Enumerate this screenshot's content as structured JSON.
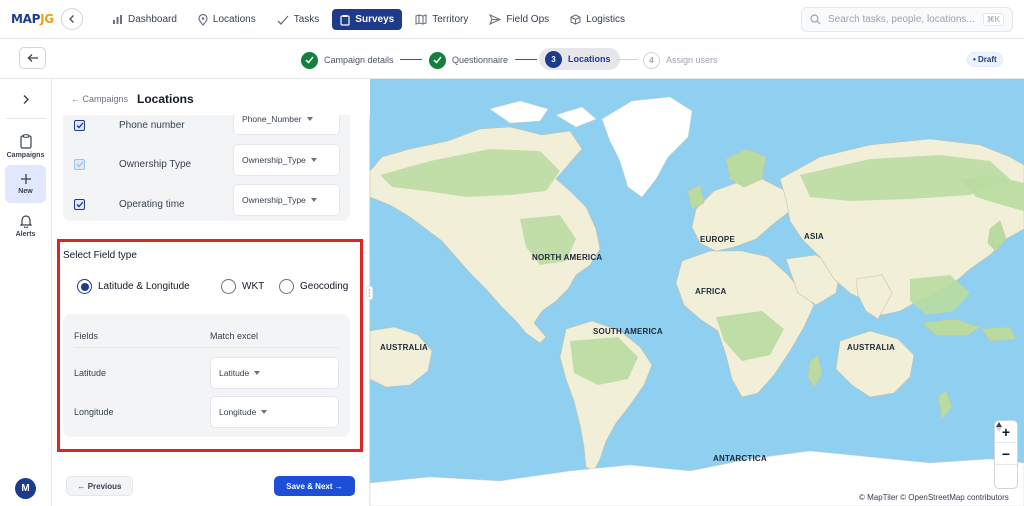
{
  "app": {
    "logo_main": "MAP",
    "logo_accent": "JG"
  },
  "nav": {
    "items": [
      {
        "label": "Dashboard",
        "icon": "bar-chart-icon"
      },
      {
        "label": "Locations",
        "icon": "pin-icon"
      },
      {
        "label": "Tasks",
        "icon": "check-icon"
      },
      {
        "label": "Surveys",
        "icon": "clipboard-icon",
        "active": true
      },
      {
        "label": "Territory",
        "icon": "map-icon"
      },
      {
        "label": "Field Ops",
        "icon": "send-icon"
      },
      {
        "label": "Logistics",
        "icon": "box-icon"
      }
    ]
  },
  "search": {
    "placeholder": "Search tasks, people, locations...",
    "shortcut": "⌘K"
  },
  "stepper": {
    "steps": [
      {
        "label": "Campaign details",
        "state": "done"
      },
      {
        "label": "Questionnaire",
        "state": "done"
      },
      {
        "label": "Locations",
        "number": "3",
        "state": "current"
      },
      {
        "label": "Assign users",
        "number": "4",
        "state": "todo"
      }
    ],
    "status_badge": "• Draft"
  },
  "rail": {
    "items": [
      {
        "label": "Campaigns",
        "icon": "clipboard-icon"
      },
      {
        "label": "New",
        "icon": "plus-icon",
        "active": true
      },
      {
        "label": "Alerts",
        "icon": "bell-icon"
      }
    ],
    "avatar_initial": "M"
  },
  "panel": {
    "breadcrumb": "← Campaigns",
    "title": "Locations",
    "mapping_rows": [
      {
        "label": "Phone number",
        "value": "Phone_Number",
        "checked": true
      },
      {
        "label": "Ownership Type",
        "value": "Ownership_Type",
        "checked": true
      },
      {
        "label": "Operating time",
        "value": "Ownership_Type",
        "checked": true
      }
    ],
    "field_type": {
      "title": "Select Field type",
      "options": [
        "Latitude & Longitude",
        "WKT",
        "Geocoding"
      ],
      "selected": "Latitude & Longitude"
    },
    "fields_table": {
      "headers": [
        "Fields",
        "Match excel"
      ],
      "rows": [
        {
          "field": "Latitude",
          "match": "Latitude"
        },
        {
          "field": "Longitude",
          "match": "Longitude"
        }
      ]
    },
    "prev_label": "← Previous",
    "next_label": "Save & Next →"
  },
  "map": {
    "labels": {
      "north_america": "NORTH AMERICA",
      "south_america": "SOUTH AMERICA",
      "europe": "EUROPE",
      "asia": "ASIA",
      "africa": "AFRICA",
      "australia_west": "AUSTRALIA",
      "australia_east": "AUSTRALIA",
      "antarctica": "ANTARCTICA"
    },
    "zoom_in": "+",
    "zoom_out": "−",
    "attribution": "© MapTiler © OpenStreetMap contributors",
    "colors": {
      "water": "#8fcff0",
      "land": "#f2efd9",
      "forest": "#b9dba0",
      "ice": "#ffffff"
    }
  }
}
